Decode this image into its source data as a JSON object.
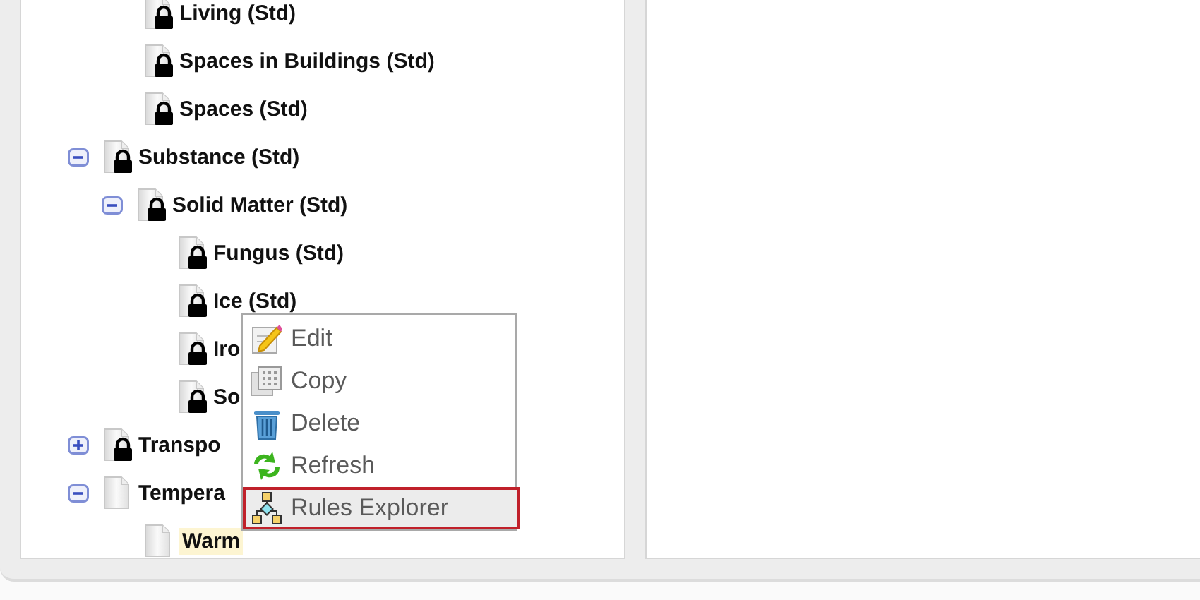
{
  "tree": {
    "hidden_parent_children": [
      {
        "label": "Living (Std)",
        "locked": true,
        "selected": false
      },
      {
        "label": "Spaces in Buildings (Std)",
        "locked": true,
        "selected": false
      },
      {
        "label": "Spaces (Std)",
        "locked": true,
        "selected": false
      }
    ],
    "items": [
      {
        "label": "Substance (Std)",
        "locked": true,
        "expanded": true,
        "selected": false,
        "children": [
          {
            "label": "Solid Matter (Std)",
            "locked": true,
            "expanded": true,
            "selected": false,
            "children": [
              {
                "label": "Fungus (Std)",
                "locked": true,
                "selected": false
              },
              {
                "label": "Ice (Std)",
                "locked": true,
                "selected": false
              },
              {
                "label": "Iro",
                "locked": true,
                "selected": false
              },
              {
                "label": "So",
                "locked": true,
                "selected": false
              }
            ]
          }
        ]
      },
      {
        "label": "Transpo",
        "locked": true,
        "expanded": false,
        "selected": false
      },
      {
        "label": "Tempera",
        "locked": false,
        "expanded": true,
        "selected": false,
        "children": [
          {
            "label": "Warm",
            "locked": false,
            "selected": true
          }
        ]
      }
    ]
  },
  "context_menu": {
    "items": [
      {
        "label": "Edit",
        "kind": "edit",
        "selected": false
      },
      {
        "label": "Copy",
        "kind": "copy",
        "selected": false
      },
      {
        "label": "Delete",
        "kind": "delete",
        "selected": false
      },
      {
        "label": "Refresh",
        "kind": "refresh",
        "selected": false
      },
      {
        "label": "Rules Explorer",
        "kind": "rules",
        "selected": true
      }
    ]
  }
}
